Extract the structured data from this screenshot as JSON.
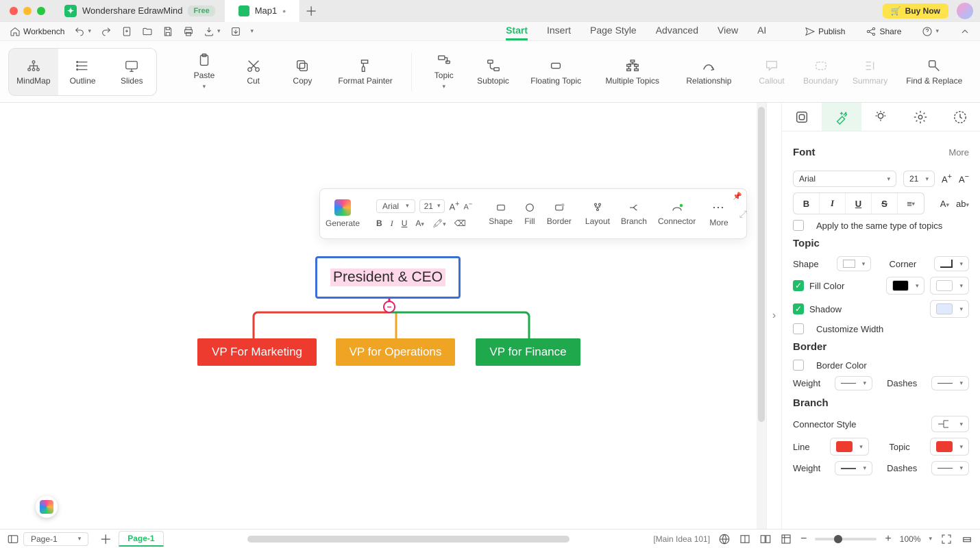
{
  "app": {
    "name": "Wondershare EdrawMind",
    "badge": "Free"
  },
  "doc_tab": {
    "name": "Map1"
  },
  "buy_now": "Buy Now",
  "toolbar": {
    "workbench": "Workbench"
  },
  "menu": {
    "start": "Start",
    "insert": "Insert",
    "page_style": "Page Style",
    "advanced": "Advanced",
    "view": "View",
    "ai": "AI"
  },
  "toolbar_right": {
    "publish": "Publish",
    "share": "Share"
  },
  "view_switch": {
    "mindmap": "MindMap",
    "outline": "Outline",
    "slides": "Slides"
  },
  "ribbon": {
    "paste": "Paste",
    "cut": "Cut",
    "copy": "Copy",
    "format_painter": "Format Painter",
    "topic": "Topic",
    "subtopic": "Subtopic",
    "floating": "Floating Topic",
    "multiple": "Multiple Topics",
    "relationship": "Relationship",
    "callout": "Callout",
    "boundary": "Boundary",
    "summary": "Summary",
    "find_replace": "Find & Replace"
  },
  "float_tb": {
    "generate": "Generate",
    "font": "Arial",
    "size": "21",
    "shape": "Shape",
    "fill": "Fill",
    "border": "Border",
    "layout": "Layout",
    "branch": "Branch",
    "connector": "Connector",
    "more": "More"
  },
  "mindmap": {
    "root": "President & CEO",
    "children": [
      {
        "label": "VP For Marketing",
        "color": "#ed3b2f"
      },
      {
        "label": "VP for Operations",
        "color": "#f0a423"
      },
      {
        "label": "VP for Finance",
        "color": "#1fa94c"
      }
    ]
  },
  "panel": {
    "font": {
      "title": "Font",
      "more": "More",
      "family": "Arial",
      "size": "21",
      "apply": "Apply to the same type of topics"
    },
    "topic": {
      "title": "Topic",
      "shape": "Shape",
      "corner": "Corner",
      "fill": "Fill Color",
      "shadow": "Shadow",
      "customize": "Customize Width"
    },
    "border": {
      "title": "Border",
      "color": "Border Color",
      "weight": "Weight",
      "dashes": "Dashes"
    },
    "branch": {
      "title": "Branch",
      "connector": "Connector Style",
      "line": "Line",
      "topic": "Topic",
      "weight": "Weight",
      "dashes": "Dashes",
      "line_color": "#ed3b2f",
      "topic_color": "#ed3b2f"
    }
  },
  "status": {
    "page_name": "Page-1",
    "page_tab": "Page-1",
    "context": "[Main Idea 101]",
    "zoom": "100%"
  }
}
